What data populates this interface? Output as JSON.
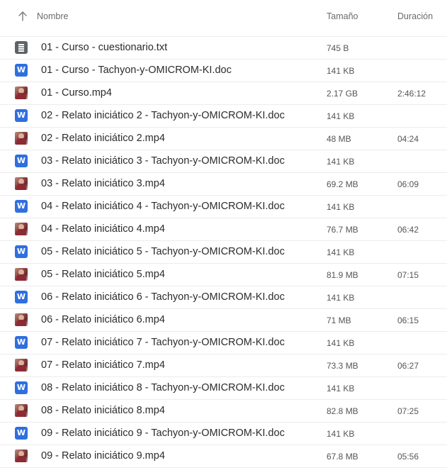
{
  "header": {
    "name_label": "Nombre",
    "size_label": "Tamaño",
    "duration_label": "Duración",
    "sort_icon": "arrow-up-icon"
  },
  "files": [
    {
      "type": "txt",
      "icon": "text-file-icon",
      "name": "01 - Curso - cuestionario.txt",
      "size": "745 B",
      "duration": ""
    },
    {
      "type": "word",
      "icon": "word-doc-icon",
      "icon_letter": "W",
      "name": "01 - Curso - Tachyon-y-OMICROM-KI.doc",
      "size": "141 KB",
      "duration": ""
    },
    {
      "type": "video",
      "icon": "video-thumbnail-icon",
      "name": "01 - Curso.mp4",
      "size": "2.17 GB",
      "duration": "2:46:12"
    },
    {
      "type": "word",
      "icon": "word-doc-icon",
      "icon_letter": "W",
      "name": "02 - Relato iniciático 2 - Tachyon-y-OMICROM-KI.doc",
      "size": "141 KB",
      "duration": ""
    },
    {
      "type": "video",
      "icon": "video-thumbnail-icon",
      "name": "02 - Relato iniciático 2.mp4",
      "size": "48 MB",
      "duration": "04:24"
    },
    {
      "type": "word",
      "icon": "word-doc-icon",
      "icon_letter": "W",
      "name": "03 - Relato iniciático 3 - Tachyon-y-OMICROM-KI.doc",
      "size": "141 KB",
      "duration": ""
    },
    {
      "type": "video",
      "icon": "video-thumbnail-icon",
      "name": "03 - Relato iniciático 3.mp4",
      "size": "69.2 MB",
      "duration": "06:09"
    },
    {
      "type": "word",
      "icon": "word-doc-icon",
      "icon_letter": "W",
      "name": "04 - Relato iniciático 4 - Tachyon-y-OMICROM-KI.doc",
      "size": "141 KB",
      "duration": ""
    },
    {
      "type": "video",
      "icon": "video-thumbnail-icon",
      "name": "04 - Relato iniciático 4.mp4",
      "size": "76.7 MB",
      "duration": "06:42"
    },
    {
      "type": "word",
      "icon": "word-doc-icon",
      "icon_letter": "W",
      "name": "05 - Relato iniciático 5 - Tachyon-y-OMICROM-KI.doc",
      "size": "141 KB",
      "duration": ""
    },
    {
      "type": "video",
      "icon": "video-thumbnail-icon",
      "name": "05 - Relato iniciático 5.mp4",
      "size": "81.9 MB",
      "duration": "07:15"
    },
    {
      "type": "word",
      "icon": "word-doc-icon",
      "icon_letter": "W",
      "name": "06 - Relato iniciático 6 - Tachyon-y-OMICROM-KI.doc",
      "size": "141 KB",
      "duration": ""
    },
    {
      "type": "video",
      "icon": "video-thumbnail-icon",
      "name": "06 - Relato iniciático 6.mp4",
      "size": "71 MB",
      "duration": "06:15"
    },
    {
      "type": "word",
      "icon": "word-doc-icon",
      "icon_letter": "W",
      "name": "07 - Relato iniciático 7 - Tachyon-y-OMICROM-KI.doc",
      "size": "141 KB",
      "duration": ""
    },
    {
      "type": "video",
      "icon": "video-thumbnail-icon",
      "name": "07 - Relato iniciático 7.mp4",
      "size": "73.3 MB",
      "duration": "06:27"
    },
    {
      "type": "word",
      "icon": "word-doc-icon",
      "icon_letter": "W",
      "name": "08 - Relato iniciático 8 - Tachyon-y-OMICROM-KI.doc",
      "size": "141 KB",
      "duration": ""
    },
    {
      "type": "video",
      "icon": "video-thumbnail-icon",
      "name": "08 - Relato iniciático 8.mp4",
      "size": "82.8 MB",
      "duration": "07:25"
    },
    {
      "type": "word",
      "icon": "word-doc-icon",
      "icon_letter": "W",
      "name": "09 - Relato iniciático 9 - Tachyon-y-OMICROM-KI.doc",
      "size": "141 KB",
      "duration": ""
    },
    {
      "type": "video",
      "icon": "video-thumbnail-icon",
      "name": "09 - Relato iniciático 9.mp4",
      "size": "67.8 MB",
      "duration": "05:56"
    }
  ],
  "colors": {
    "word_icon": "#2f6fdf",
    "txt_icon": "#5f6368",
    "divider": "#ececec",
    "header_text": "#6b6b6b"
  }
}
